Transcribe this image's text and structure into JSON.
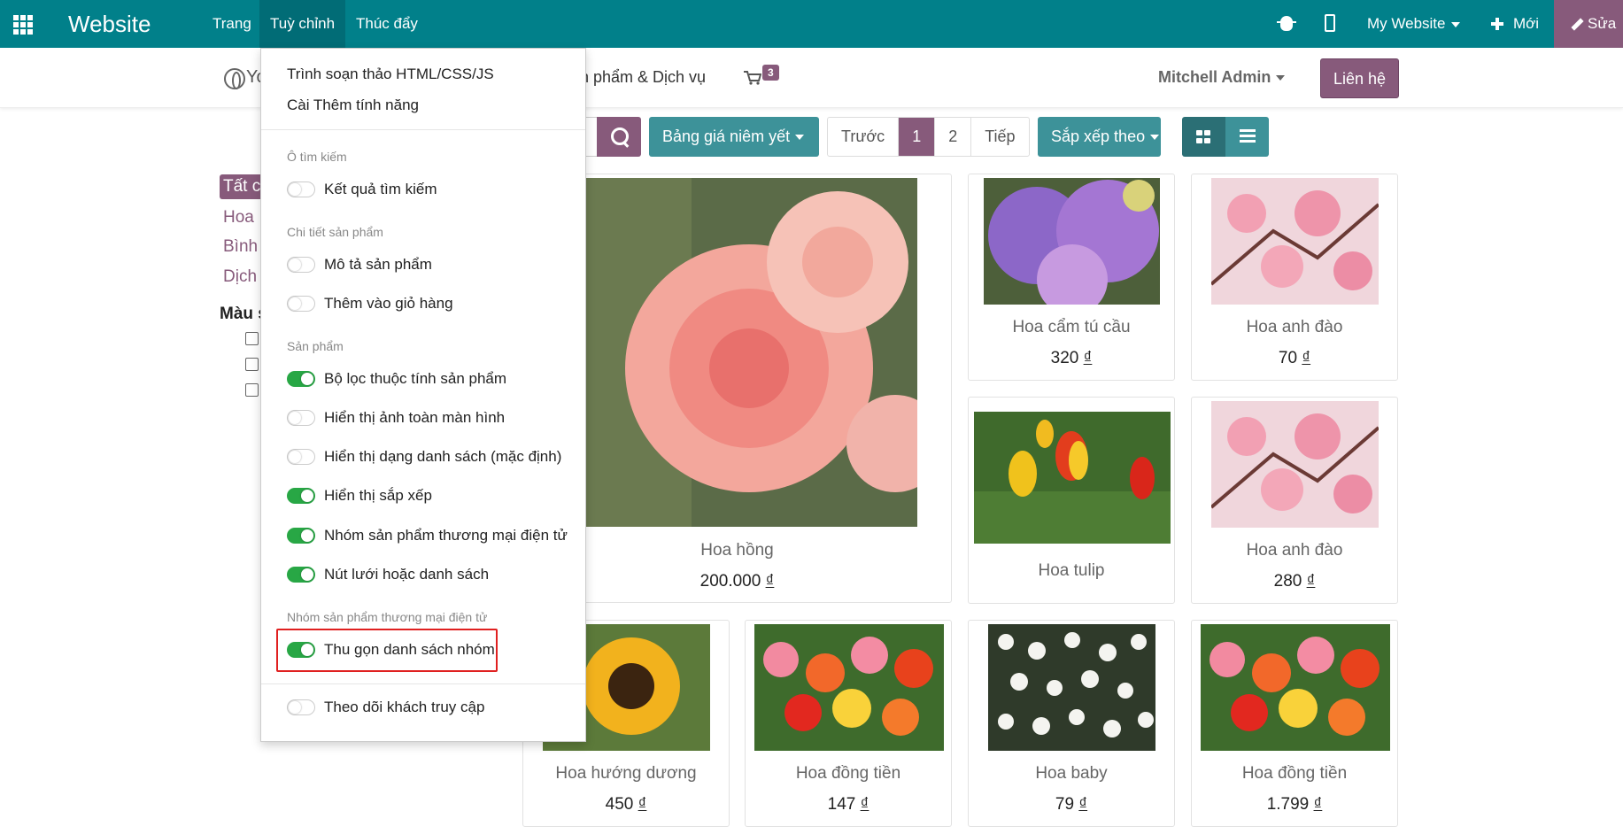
{
  "topbar": {
    "brand": "Website",
    "menus": [
      "Trang",
      "Tuỳ chỉnh",
      "Thúc đẩy"
    ],
    "website_selector": "My Website",
    "new_label": "Mới",
    "edit_label": "Sửa",
    "color": "#01808a"
  },
  "site_header": {
    "logo_text": "Yo",
    "nav_products": "n phẩm & Dịch vụ",
    "cart_count": "3",
    "user": "Mitchell Admin",
    "contact": "Liên hệ"
  },
  "sidebar": {
    "categories": [
      "Tất c",
      "Hoa",
      "Bình",
      "Dịch"
    ],
    "filter_title": "Màu s"
  },
  "toolbar": {
    "pricelist": "Bảng giá niêm yết",
    "pager": [
      "Trước",
      "1",
      "2",
      "Tiếp"
    ],
    "sort": "Sắp xếp theo"
  },
  "products": [
    {
      "name": "Hoa hồng",
      "price": "200.000",
      "currency": "₫"
    },
    {
      "name": "Hoa cẩm tú cầu",
      "price": "320",
      "currency": "₫"
    },
    {
      "name": "Hoa anh đào",
      "price": "70",
      "currency": "₫"
    },
    {
      "name": "Hoa tulip",
      "price": "",
      "currency": ""
    },
    {
      "name": "Hoa anh đào",
      "price": "280",
      "currency": "₫"
    },
    {
      "name": "Hoa hướng dương",
      "price": "450",
      "currency": "₫"
    },
    {
      "name": "Hoa đồng tiền",
      "price": "147",
      "currency": "₫"
    },
    {
      "name": "Hoa baby",
      "price": "79",
      "currency": "₫"
    },
    {
      "name": "Hoa đồng tiền",
      "price": "1.799",
      "currency": "₫"
    }
  ],
  "dropdown": {
    "links": [
      "Trình soạn thảo HTML/CSS/JS",
      "Cài Thêm tính năng"
    ],
    "sections": [
      {
        "header": "Ô tìm kiếm",
        "options": [
          {
            "label": "Kết quả tìm kiếm",
            "on": false
          }
        ]
      },
      {
        "header": "Chi tiết sản phẩm",
        "options": [
          {
            "label": "Mô tả sản phẩm",
            "on": false
          },
          {
            "label": "Thêm vào giỏ hàng",
            "on": false
          }
        ]
      },
      {
        "header": "Sản phẩm",
        "options": [
          {
            "label": "Bộ lọc thuộc tính sản phẩm",
            "on": true
          },
          {
            "label": "Hiển thị ảnh toàn màn hình",
            "on": false
          },
          {
            "label": "Hiển thị dạng danh sách (mặc định)",
            "on": false
          },
          {
            "label": "Hiển thị sắp xếp",
            "on": true
          },
          {
            "label": "Nhóm sản phẩm thương mại điện tử",
            "on": true
          },
          {
            "label": "Nút lưới hoặc danh sách",
            "on": true
          }
        ]
      },
      {
        "header": "Nhóm sản phẩm thương mại điện tử",
        "options": [
          {
            "label": "Thu gọn danh sách nhóm",
            "on": true
          }
        ]
      }
    ],
    "footer_option": {
      "label": "Theo dõi khách truy cập",
      "on": false
    }
  }
}
